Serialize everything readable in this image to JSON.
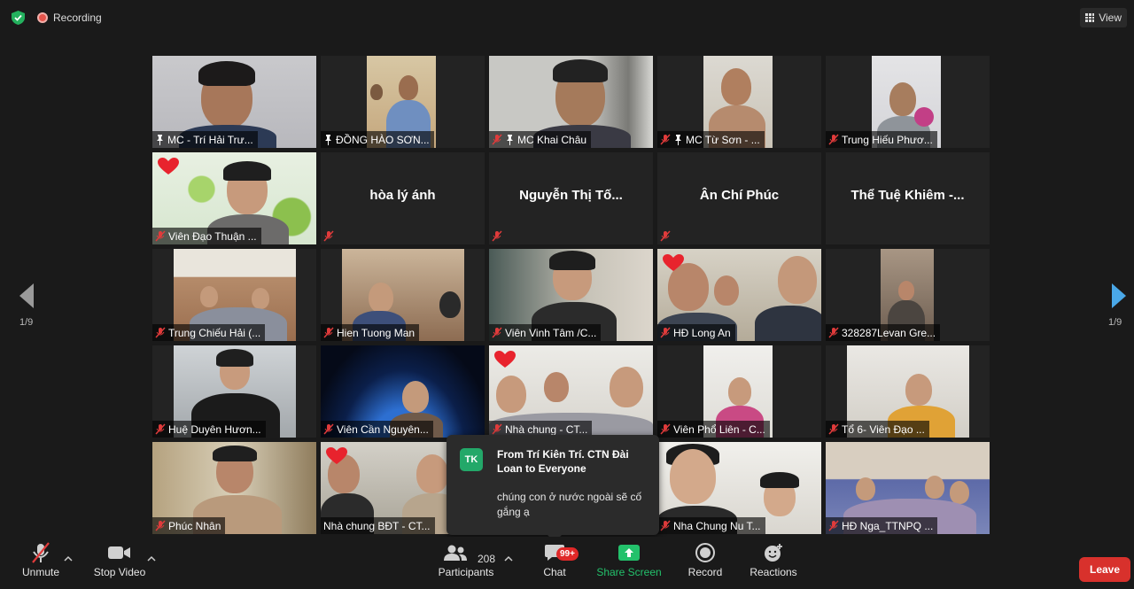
{
  "topbar": {
    "recording_label": "Recording",
    "view_label": "View"
  },
  "paging": {
    "left_page": "1/9",
    "right_page": "1/9"
  },
  "tiles": [
    {
      "name": "MC - Trí Hải Trư...",
      "pinned": true,
      "muted": false,
      "video": true,
      "active": true
    },
    {
      "name": "ĐỒNG HÀO SƠN...",
      "pinned": true,
      "muted": false,
      "video": true
    },
    {
      "name": "MC Khai Châu",
      "pinned": true,
      "muted": true,
      "video": true
    },
    {
      "name": "MC Từ Sơn - ...",
      "pinned": true,
      "muted": true,
      "video": true
    },
    {
      "name": "Trung Hiếu Phươ...",
      "pinned": false,
      "muted": true,
      "video": true
    },
    {
      "name": "Viên Đạo Thuận ...",
      "pinned": false,
      "muted": true,
      "video": true,
      "heart": true
    },
    {
      "name": "hòa lý ánh",
      "pinned": false,
      "muted": true,
      "video": false
    },
    {
      "name": "Nguyễn Thị Tố...",
      "pinned": false,
      "muted": true,
      "video": false
    },
    {
      "name": "Ân Chí Phúc",
      "pinned": false,
      "muted": true,
      "video": false
    },
    {
      "name": "Thể Tuệ Khiêm -...",
      "pinned": false,
      "muted": true,
      "video": false
    },
    {
      "name": "Trung Chiếu Hải (...",
      "pinned": false,
      "muted": true,
      "video": true
    },
    {
      "name": "Hien Tuong Man",
      "pinned": false,
      "muted": true,
      "video": true
    },
    {
      "name": "Viên Vinh Tâm /C...",
      "pinned": false,
      "muted": true,
      "video": true
    },
    {
      "name": "HĐ Long An",
      "pinned": false,
      "muted": true,
      "video": true,
      "heart": true
    },
    {
      "name": "328287Levan Gre...",
      "pinned": false,
      "muted": true,
      "video": true
    },
    {
      "name": "Huệ Duyên Hươn...",
      "pinned": false,
      "muted": true,
      "video": true
    },
    {
      "name": "Viên Cần Nguyên...",
      "pinned": false,
      "muted": true,
      "video": true
    },
    {
      "name": "Nhà chung - CT...",
      "pinned": false,
      "muted": true,
      "video": true,
      "heart": true
    },
    {
      "name": "Viên Phổ Liên - C...",
      "pinned": false,
      "muted": true,
      "video": true
    },
    {
      "name": "Tổ 6- Viên Đạo ...",
      "pinned": false,
      "muted": true,
      "video": true
    },
    {
      "name": "Phúc Nhân",
      "pinned": false,
      "muted": true,
      "video": true
    },
    {
      "name": "Nhà chung BĐT - CT...",
      "pinned": false,
      "muted": true,
      "video": true,
      "heart": true
    },
    {
      "name": "",
      "pinned": false,
      "muted": false,
      "video": true
    },
    {
      "name": "Nha Chung Nu T...",
      "pinned": false,
      "muted": true,
      "video": true
    },
    {
      "name": "HĐ Nga_TTNPQ ...",
      "pinned": false,
      "muted": true,
      "video": true
    }
  ],
  "chat_popup": {
    "avatar_initials": "TK",
    "from": "From Trí Kiên Trí. CTN Đài Loan to Everyone",
    "message": "chúng con ở nước ngoài sẽ cố gắng ạ"
  },
  "toolbar": {
    "unmute_label": "Unmute",
    "stop_video_label": "Stop Video",
    "participants_label": "Participants",
    "participants_count": "208",
    "chat_label": "Chat",
    "chat_badge": "99+",
    "share_screen_label": "Share Screen",
    "record_label": "Record",
    "reactions_label": "Reactions",
    "leave_label": "Leave"
  },
  "colors": {
    "active_speaker_border": "#b9d94a",
    "share_screen_green": "#23c16b",
    "leave_red": "#d8312c",
    "recording_red": "#e5544b",
    "badge_red": "#e02828"
  }
}
